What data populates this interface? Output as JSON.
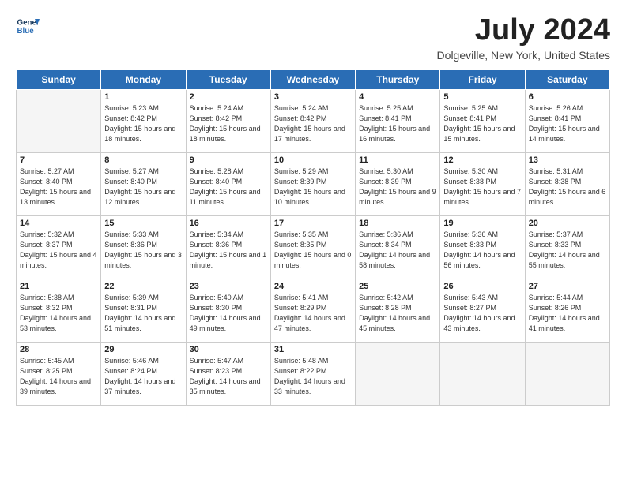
{
  "app": {
    "logo_line1": "General",
    "logo_line2": "Blue"
  },
  "header": {
    "month": "July 2024",
    "location": "Dolgeville, New York, United States"
  },
  "columns": [
    "Sunday",
    "Monday",
    "Tuesday",
    "Wednesday",
    "Thursday",
    "Friday",
    "Saturday"
  ],
  "weeks": [
    [
      {
        "day": "",
        "empty": true
      },
      {
        "day": "1",
        "sunrise": "Sunrise: 5:23 AM",
        "sunset": "Sunset: 8:42 PM",
        "daylight": "Daylight: 15 hours and 18 minutes."
      },
      {
        "day": "2",
        "sunrise": "Sunrise: 5:24 AM",
        "sunset": "Sunset: 8:42 PM",
        "daylight": "Daylight: 15 hours and 18 minutes."
      },
      {
        "day": "3",
        "sunrise": "Sunrise: 5:24 AM",
        "sunset": "Sunset: 8:42 PM",
        "daylight": "Daylight: 15 hours and 17 minutes."
      },
      {
        "day": "4",
        "sunrise": "Sunrise: 5:25 AM",
        "sunset": "Sunset: 8:41 PM",
        "daylight": "Daylight: 15 hours and 16 minutes."
      },
      {
        "day": "5",
        "sunrise": "Sunrise: 5:25 AM",
        "sunset": "Sunset: 8:41 PM",
        "daylight": "Daylight: 15 hours and 15 minutes."
      },
      {
        "day": "6",
        "sunrise": "Sunrise: 5:26 AM",
        "sunset": "Sunset: 8:41 PM",
        "daylight": "Daylight: 15 hours and 14 minutes."
      }
    ],
    [
      {
        "day": "7",
        "sunrise": "Sunrise: 5:27 AM",
        "sunset": "Sunset: 8:40 PM",
        "daylight": "Daylight: 15 hours and 13 minutes."
      },
      {
        "day": "8",
        "sunrise": "Sunrise: 5:27 AM",
        "sunset": "Sunset: 8:40 PM",
        "daylight": "Daylight: 15 hours and 12 minutes."
      },
      {
        "day": "9",
        "sunrise": "Sunrise: 5:28 AM",
        "sunset": "Sunset: 8:40 PM",
        "daylight": "Daylight: 15 hours and 11 minutes."
      },
      {
        "day": "10",
        "sunrise": "Sunrise: 5:29 AM",
        "sunset": "Sunset: 8:39 PM",
        "daylight": "Daylight: 15 hours and 10 minutes."
      },
      {
        "day": "11",
        "sunrise": "Sunrise: 5:30 AM",
        "sunset": "Sunset: 8:39 PM",
        "daylight": "Daylight: 15 hours and 9 minutes."
      },
      {
        "day": "12",
        "sunrise": "Sunrise: 5:30 AM",
        "sunset": "Sunset: 8:38 PM",
        "daylight": "Daylight: 15 hours and 7 minutes."
      },
      {
        "day": "13",
        "sunrise": "Sunrise: 5:31 AM",
        "sunset": "Sunset: 8:38 PM",
        "daylight": "Daylight: 15 hours and 6 minutes."
      }
    ],
    [
      {
        "day": "14",
        "sunrise": "Sunrise: 5:32 AM",
        "sunset": "Sunset: 8:37 PM",
        "daylight": "Daylight: 15 hours and 4 minutes."
      },
      {
        "day": "15",
        "sunrise": "Sunrise: 5:33 AM",
        "sunset": "Sunset: 8:36 PM",
        "daylight": "Daylight: 15 hours and 3 minutes."
      },
      {
        "day": "16",
        "sunrise": "Sunrise: 5:34 AM",
        "sunset": "Sunset: 8:36 PM",
        "daylight": "Daylight: 15 hours and 1 minute."
      },
      {
        "day": "17",
        "sunrise": "Sunrise: 5:35 AM",
        "sunset": "Sunset: 8:35 PM",
        "daylight": "Daylight: 15 hours and 0 minutes."
      },
      {
        "day": "18",
        "sunrise": "Sunrise: 5:36 AM",
        "sunset": "Sunset: 8:34 PM",
        "daylight": "Daylight: 14 hours and 58 minutes."
      },
      {
        "day": "19",
        "sunrise": "Sunrise: 5:36 AM",
        "sunset": "Sunset: 8:33 PM",
        "daylight": "Daylight: 14 hours and 56 minutes."
      },
      {
        "day": "20",
        "sunrise": "Sunrise: 5:37 AM",
        "sunset": "Sunset: 8:33 PM",
        "daylight": "Daylight: 14 hours and 55 minutes."
      }
    ],
    [
      {
        "day": "21",
        "sunrise": "Sunrise: 5:38 AM",
        "sunset": "Sunset: 8:32 PM",
        "daylight": "Daylight: 14 hours and 53 minutes."
      },
      {
        "day": "22",
        "sunrise": "Sunrise: 5:39 AM",
        "sunset": "Sunset: 8:31 PM",
        "daylight": "Daylight: 14 hours and 51 minutes."
      },
      {
        "day": "23",
        "sunrise": "Sunrise: 5:40 AM",
        "sunset": "Sunset: 8:30 PM",
        "daylight": "Daylight: 14 hours and 49 minutes."
      },
      {
        "day": "24",
        "sunrise": "Sunrise: 5:41 AM",
        "sunset": "Sunset: 8:29 PM",
        "daylight": "Daylight: 14 hours and 47 minutes."
      },
      {
        "day": "25",
        "sunrise": "Sunrise: 5:42 AM",
        "sunset": "Sunset: 8:28 PM",
        "daylight": "Daylight: 14 hours and 45 minutes."
      },
      {
        "day": "26",
        "sunrise": "Sunrise: 5:43 AM",
        "sunset": "Sunset: 8:27 PM",
        "daylight": "Daylight: 14 hours and 43 minutes."
      },
      {
        "day": "27",
        "sunrise": "Sunrise: 5:44 AM",
        "sunset": "Sunset: 8:26 PM",
        "daylight": "Daylight: 14 hours and 41 minutes."
      }
    ],
    [
      {
        "day": "28",
        "sunrise": "Sunrise: 5:45 AM",
        "sunset": "Sunset: 8:25 PM",
        "daylight": "Daylight: 14 hours and 39 minutes."
      },
      {
        "day": "29",
        "sunrise": "Sunrise: 5:46 AM",
        "sunset": "Sunset: 8:24 PM",
        "daylight": "Daylight: 14 hours and 37 minutes."
      },
      {
        "day": "30",
        "sunrise": "Sunrise: 5:47 AM",
        "sunset": "Sunset: 8:23 PM",
        "daylight": "Daylight: 14 hours and 35 minutes."
      },
      {
        "day": "31",
        "sunrise": "Sunrise: 5:48 AM",
        "sunset": "Sunset: 8:22 PM",
        "daylight": "Daylight: 14 hours and 33 minutes."
      },
      {
        "day": "",
        "empty": true
      },
      {
        "day": "",
        "empty": true
      },
      {
        "day": "",
        "empty": true
      }
    ]
  ]
}
